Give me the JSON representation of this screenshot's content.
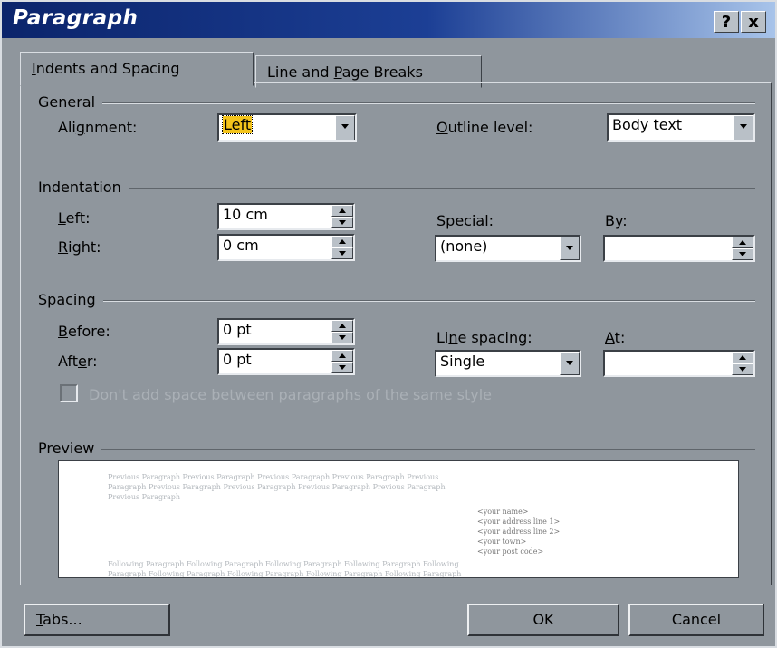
{
  "window": {
    "title": "Paragraph",
    "help_label": "?",
    "close_label": "x"
  },
  "tabs": [
    {
      "label_pre": "",
      "label_key": "I",
      "label_post": "ndents and Spacing",
      "active": true
    },
    {
      "label_pre": "Line and ",
      "label_key": "P",
      "label_post": "age Breaks",
      "active": false
    }
  ],
  "general": {
    "heading": "General",
    "alignment_label_pre": "Ali",
    "alignment_label_key": "g",
    "alignment_label_post": "nment:",
    "alignment_value": "Left",
    "outline_label_key": "O",
    "outline_label_post": "utline level:",
    "outline_value": "Body text"
  },
  "indentation": {
    "heading": "Indentation",
    "left_key": "L",
    "left_post": "eft:",
    "left_value": "10 cm",
    "right_key": "R",
    "right_post": "ight:",
    "right_value": "0 cm",
    "special_key": "S",
    "special_post": "pecial:",
    "special_value": "(none)",
    "by_pre": "B",
    "by_key": "y",
    "by_post": ":",
    "by_value": ""
  },
  "spacing": {
    "heading": "Spacing",
    "before_key": "B",
    "before_post": "efore:",
    "before_value": "0 pt",
    "after_pre": "Aft",
    "after_key": "e",
    "after_post": "r:",
    "after_value": "0 pt",
    "line_pre": "Li",
    "line_key": "n",
    "line_post": "e spacing:",
    "line_value": "Single",
    "at_key": "A",
    "at_post": "t:",
    "at_value": "",
    "dont_add_label": "Don't add space between paragraphs of the same style"
  },
  "preview": {
    "heading": "Preview",
    "previous_line_1": "Previous Paragraph Previous Paragraph Previous Paragraph Previous Paragraph Previous",
    "previous_line_2": "Paragraph Previous Paragraph Previous Paragraph Previous Paragraph Previous Paragraph",
    "previous_line_3": "Previous Paragraph",
    "address_1": "<your name>",
    "address_2": "<your address line 1>",
    "address_3": "<your address line 2>",
    "address_4": "<your town>",
    "address_5": "<your post code>",
    "following_line_1": "Following Paragraph Following Paragraph Following Paragraph Following Paragraph Following",
    "following_line_2": "Paragraph Following Paragraph Following Paragraph Following Paragraph Following Paragraph"
  },
  "buttons": {
    "tabs_key": "T",
    "tabs_post": "abs...",
    "ok": "OK",
    "cancel": "Cancel"
  },
  "colors": {
    "highlight": "#f4c41b",
    "titlebar_start": "#0b246b",
    "titlebar_end": "#a8c4ea"
  }
}
